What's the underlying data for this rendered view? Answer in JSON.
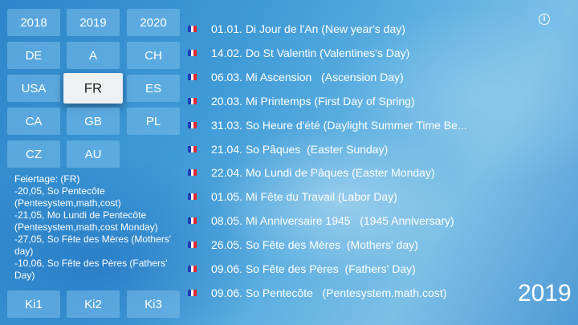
{
  "year_buttons": [
    "2018",
    "2019",
    "2020"
  ],
  "country_buttons": [
    "DE",
    "A",
    "CH",
    "USA",
    "FR",
    "ES",
    "CA",
    "GB",
    "PL",
    "CZ",
    "AU"
  ],
  "selected_country": "FR",
  "holiday_notes": [
    "Feiertage: (FR)",
    "-20,05, So Pentecôte (Pentesystem,math,cost)",
    "-21,05, Mo Lundi de Pentecôte (Pentesystem,math,cost Monday)",
    "-27,05, So Fête des Mères  (Mothers' day)",
    "-10,06, So Fête des Pères  (Fathers' Day)"
  ],
  "ki_buttons": [
    "Ki1",
    "Ki2",
    "Ki3"
  ],
  "info_icon": "info-icon",
  "current_year": "2019",
  "dates": [
    "01.01. Di Jour de l'An (New year's day)",
    "14.02. Do St Valentin (Valentines's Day)",
    "06.03. Mi Ascension   (Ascension Day)",
    "20.03. Mi Printemps (First Day of Spring)",
    "31.03. So Heure d'été (Daylight Summer Time Be...",
    "21.04. So Pâques  (Easter Sunday)",
    "22.04. Mo Lundi de Pâques (Easter Monday)",
    "01.05. Mi Fête du Travail (Labor Day)",
    "08.05. Mi Anniversaire 1945   (1945 Anniversary)",
    "26.05. So Fête des Mères  (Mothers' day)",
    "09.06. So Fête des Pères  (Fathers' Day)",
    "09.06. So Pentecôte   (Pentesystem.math.cost)"
  ]
}
